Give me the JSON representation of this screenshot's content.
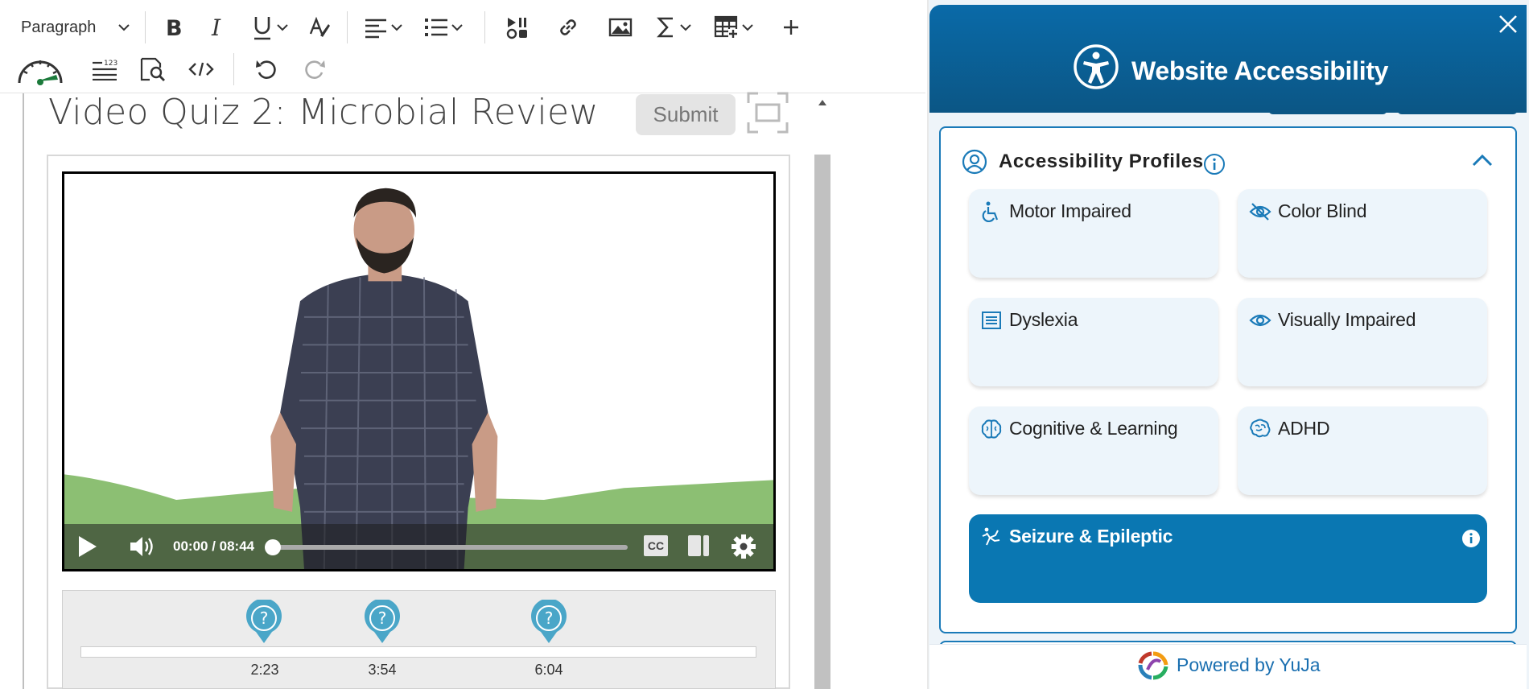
{
  "toolbar": {
    "paragraph_select": "Paragraph",
    "icons": [
      "bold-icon",
      "italic-icon",
      "underline-icon",
      "text-color-icon",
      "align-icon",
      "list-icon",
      "media-icon",
      "link-icon",
      "image-icon",
      "sigma-icon",
      "table-icon",
      "plus-icon",
      "gauge-icon",
      "word-count-icon",
      "find-icon",
      "code-icon",
      "undo-icon",
      "redo-icon"
    ]
  },
  "content": {
    "quiz_title": "Video Quiz 2: Microbial Review",
    "submit_label": "Submit"
  },
  "video": {
    "time_display": "00:00 / 08:44",
    "cc_label": "CC",
    "playback_progress_fraction": 0.0
  },
  "timeline": {
    "markers": [
      {
        "time": "2:23"
      },
      {
        "time": "3:54"
      },
      {
        "time": "6:04"
      }
    ],
    "marker_color": "#4aa6c8"
  },
  "a11y": {
    "title": "Website Accessibility",
    "profiles_heading": "Accessibility Profiles",
    "profiles": [
      {
        "label": "Motor Impaired",
        "icon": "wheelchair-icon",
        "selected": false
      },
      {
        "label": "Color Blind",
        "icon": "eye-slash-icon",
        "selected": false
      },
      {
        "label": "Dyslexia",
        "icon": "text-lines-icon",
        "selected": false
      },
      {
        "label": "Visually Impaired",
        "icon": "eye-icon",
        "selected": false
      },
      {
        "label": "Cognitive & Learning",
        "icon": "brain-icon",
        "selected": false
      },
      {
        "label": "ADHD",
        "icon": "brain-head-icon",
        "selected": false
      },
      {
        "label": "Seizure & Epileptic",
        "icon": "seizure-icon",
        "selected": true
      }
    ],
    "footer_text": "Powered by YuJa",
    "colors": {
      "header": "#0b5f96",
      "accent": "#1a7ab8",
      "selected_tile": "#0a77b2",
      "tile_bg": "#edf5fb"
    }
  }
}
